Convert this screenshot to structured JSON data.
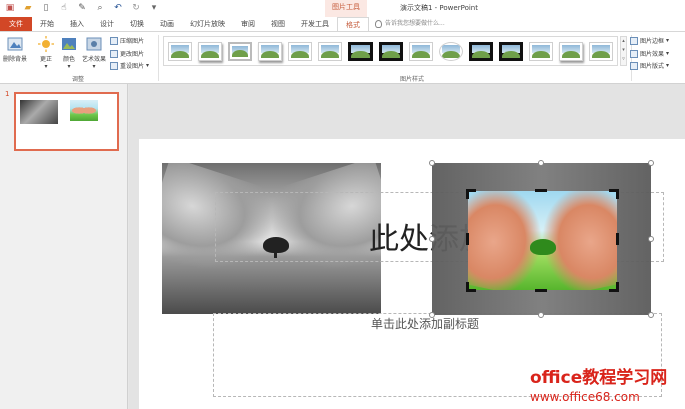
{
  "app": {
    "window_title": "演示文稿1 - PowerPoint",
    "context_tab_group": "图片工具"
  },
  "quick_access": [
    "save-icon",
    "open-icon",
    "new-icon",
    "touch-icon",
    "format-painter-icon",
    "print-preview-icon",
    "undo-icon",
    "redo-icon",
    "customize-icon"
  ],
  "tabs": [
    {
      "label": "文件"
    },
    {
      "label": "开始"
    },
    {
      "label": "插入"
    },
    {
      "label": "设计"
    },
    {
      "label": "切换"
    },
    {
      "label": "动画"
    },
    {
      "label": "幻灯片放映"
    },
    {
      "label": "审阅"
    },
    {
      "label": "视图"
    },
    {
      "label": "开发工具"
    },
    {
      "label": "格式"
    }
  ],
  "tellme": {
    "placeholder": "告诉我您想要做什么..."
  },
  "ribbon": {
    "adjust": {
      "remove_background": "删除背景",
      "corrections": "更正",
      "color": "颜色",
      "artistic_effects": "艺术效果",
      "compress": "压缩图片",
      "change": "更改图片",
      "reset": "重设图片",
      "group_label": "调整"
    },
    "picture_styles": {
      "group_label": "图片样式",
      "border": "图片边框",
      "effects": "图片效果",
      "layout": "图片版式"
    }
  },
  "slides": [
    {
      "number": "1"
    }
  ],
  "slide": {
    "title_placeholder": "单击此处添加标题",
    "title_visible": "此处添加标题",
    "subtitle_placeholder": "单击此处添加副标题"
  },
  "watermark": {
    "main": "office教程学习网",
    "url": "www.office68.com"
  },
  "colors": {
    "accent": "#d24726",
    "format_tab": "#c55a3a",
    "watermark": "#d9241b"
  }
}
